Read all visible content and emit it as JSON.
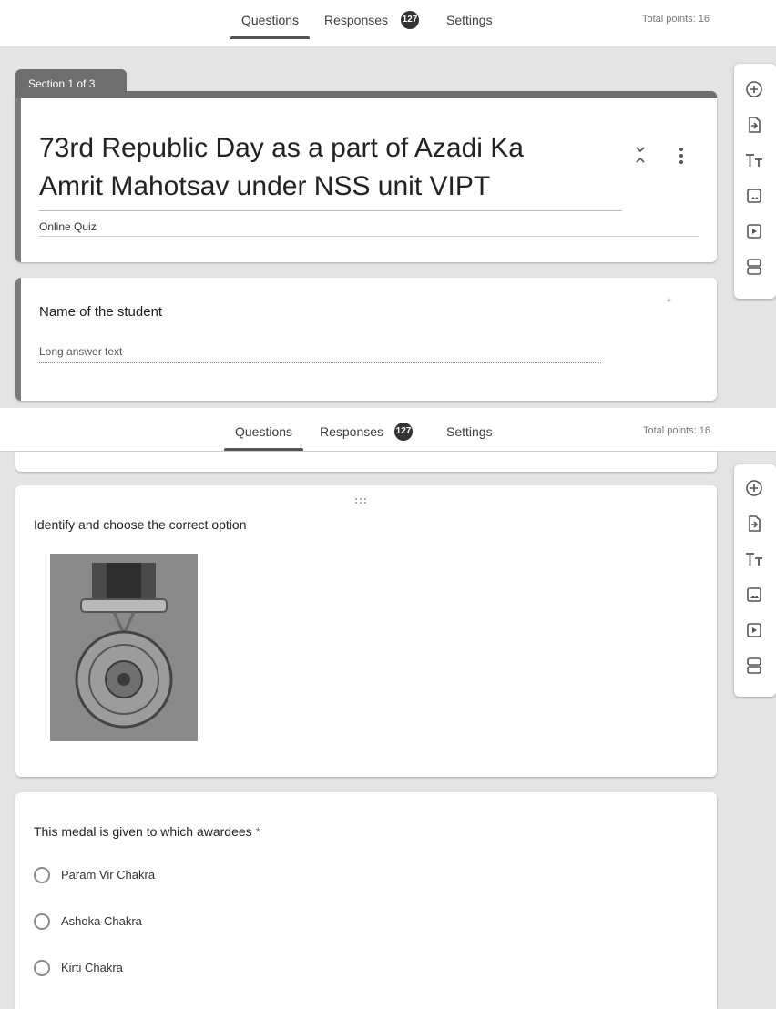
{
  "tabs": {
    "questions": "Questions",
    "responses": "Responses",
    "responses_count": "127",
    "settings": "Settings",
    "total_points": "Total points: 16"
  },
  "section": {
    "label": "Section 1 of 3"
  },
  "form": {
    "title_line1": "73rd Republic Day as a part of Azadi Ka",
    "title_line2": "Amrit Mahotsav under NSS unit VIPT",
    "description": "Online Quiz"
  },
  "q1": {
    "title": "Name of the student",
    "required_mark": "*",
    "placeholder": "Long answer text"
  },
  "q2": {
    "title": "Identify and choose the correct option"
  },
  "q3": {
    "title": "This medal is given to which awardees",
    "required_mark": "*",
    "options": [
      "Param Vir Chakra",
      "Ashoka Chakra",
      "Kirti Chakra"
    ]
  },
  "colors": {
    "accent": "#6e6e6e",
    "badge": "#333333",
    "background": "#e4e4e4"
  },
  "toolbar_icons": [
    "add-question-icon",
    "import-questions-icon",
    "add-title-icon",
    "add-image-icon",
    "add-video-icon",
    "add-section-icon"
  ]
}
